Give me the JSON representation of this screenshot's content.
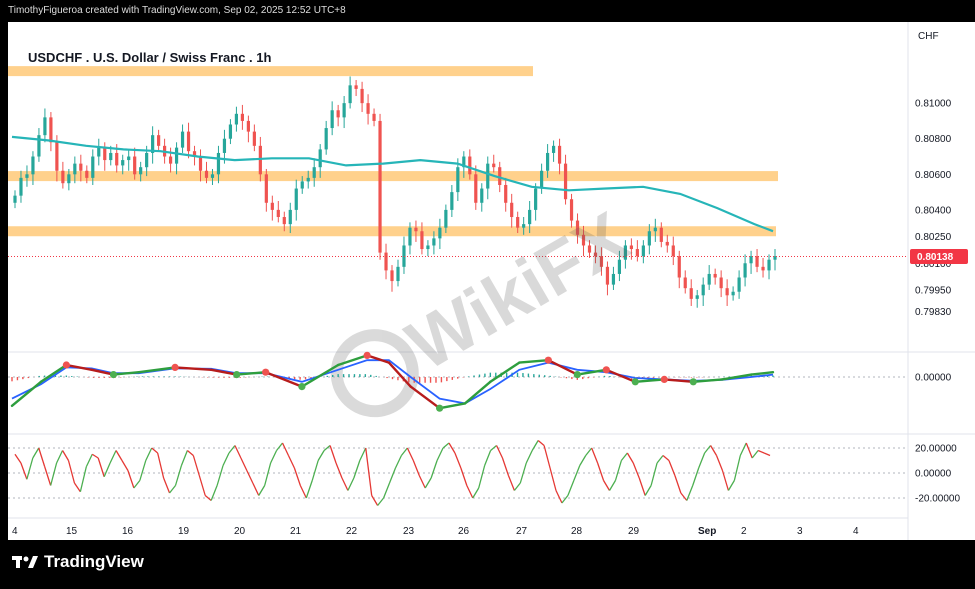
{
  "header": {
    "attribution": "TimothyFigueroa created with TradingView.com, Sep 02, 2025 12:52 UTC+8"
  },
  "symbol_title": "USDCHF . U.S. Dollar / Swiss Franc . 1h",
  "currency_label": "CHF",
  "brand": "TradingView",
  "watermark": "WikiFX",
  "colors": {
    "up": "#26a69a",
    "down": "#ef5350",
    "ma": "#26b5b8",
    "zone": "#ffcc80",
    "price_tag": "#f23645",
    "macd_fast": "#2e9e3e",
    "macd_slow": "#2962ff",
    "macd_down": "#b71c1c",
    "osc_up": "#4caf50",
    "osc_down": "#e53935"
  },
  "chart_data": {
    "type": "candlestick",
    "symbol": "USDCHF",
    "timeframe": "1h",
    "price_axis": {
      "ylim": [
        0.7968,
        0.8122
      ],
      "ticks": [
        "0.81000",
        "0.80800",
        "0.80600",
        "0.80400",
        "0.80250",
        "0.80100",
        "0.79950",
        "0.79830"
      ],
      "current_price": "0.80138"
    },
    "x_axis": {
      "ticks": [
        "4",
        "15",
        "16",
        "19",
        "20",
        "21",
        "22",
        "23",
        "26",
        "27",
        "28",
        "29",
        "Sep",
        "2",
        "3",
        "4"
      ]
    },
    "horizontal_zones": [
      {
        "level": 0.8118
      },
      {
        "level": 0.8059
      },
      {
        "level": 0.8028
      }
    ],
    "moving_average": [
      [
        0,
        0.8081
      ],
      [
        10,
        0.8079
      ],
      [
        20,
        0.8076
      ],
      [
        30,
        0.8074
      ],
      [
        40,
        0.8073
      ],
      [
        50,
        0.807
      ],
      [
        60,
        0.8068
      ],
      [
        70,
        0.8069
      ],
      [
        80,
        0.8069
      ],
      [
        90,
        0.8065
      ],
      [
        100,
        0.8066
      ],
      [
        110,
        0.8068
      ],
      [
        120,
        0.8066
      ],
      [
        130,
        0.8059
      ],
      [
        140,
        0.8053
      ],
      [
        150,
        0.8051
      ],
      [
        160,
        0.8052
      ],
      [
        170,
        0.8053
      ],
      [
        180,
        0.8049
      ],
      [
        190,
        0.8041
      ],
      [
        200,
        0.8032
      ],
      [
        205,
        0.8028
      ]
    ],
    "candles_close": [
      0.8048,
      0.8058,
      0.806,
      0.807,
      0.8082,
      0.8092,
      0.8078,
      0.8062,
      0.8055,
      0.806,
      0.8066,
      0.8062,
      0.8058,
      0.807,
      0.8075,
      0.8068,
      0.8072,
      0.8065,
      0.8068,
      0.807,
      0.806,
      0.8064,
      0.8072,
      0.8082,
      0.8076,
      0.807,
      0.8066,
      0.8075,
      0.8084,
      0.8073,
      0.807,
      0.8062,
      0.8058,
      0.806,
      0.8072,
      0.808,
      0.8088,
      0.8094,
      0.809,
      0.8084,
      0.8076,
      0.806,
      0.8044,
      0.804,
      0.8036,
      0.8032,
      0.804,
      0.8052,
      0.8056,
      0.8058,
      0.8064,
      0.8074,
      0.8086,
      0.8096,
      0.8092,
      0.81,
      0.811,
      0.8108,
      0.81,
      0.8094,
      0.809,
      0.8016,
      0.8006,
      0.8,
      0.8008,
      0.802,
      0.803,
      0.8028,
      0.8018,
      0.802,
      0.8024,
      0.803,
      0.804,
      0.805,
      0.8064,
      0.807,
      0.806,
      0.8044,
      0.8052,
      0.8066,
      0.8064,
      0.8054,
      0.8044,
      0.8036,
      0.803,
      0.8032,
      0.804,
      0.8052,
      0.8062,
      0.8072,
      0.8076,
      0.8066,
      0.8046,
      0.8034,
      0.8026,
      0.802,
      0.8016,
      0.8014,
      0.8008,
      0.7998,
      0.8004,
      0.8012,
      0.802,
      0.8018,
      0.8014,
      0.802,
      0.8028,
      0.803,
      0.8022,
      0.802,
      0.8014,
      0.8002,
      0.7996,
      0.799,
      0.7992,
      0.7998,
      0.8004,
      0.8002,
      0.7996,
      0.7992,
      0.7994,
      0.8002,
      0.801,
      0.8014,
      0.8008,
      0.8006,
      0.8012,
      0.8014
    ],
    "macd": {
      "zero": "0.00000",
      "fast_line": [
        [
          0,
          -0.6
        ],
        [
          8,
          -0.1
        ],
        [
          15,
          0.25
        ],
        [
          22,
          0.15
        ],
        [
          28,
          0.05
        ],
        [
          35,
          0.1
        ],
        [
          45,
          0.2
        ],
        [
          55,
          0.15
        ],
        [
          62,
          0.05
        ],
        [
          70,
          0.1
        ],
        [
          80,
          -0.2
        ],
        [
          90,
          0.25
        ],
        [
          98,
          0.45
        ],
        [
          104,
          0.3
        ],
        [
          110,
          -0.2
        ],
        [
          118,
          -0.65
        ],
        [
          125,
          -0.55
        ],
        [
          132,
          -0.1
        ],
        [
          140,
          0.3
        ],
        [
          148,
          0.35
        ],
        [
          156,
          0.05
        ],
        [
          164,
          0.15
        ],
        [
          172,
          -0.1
        ],
        [
          180,
          -0.05
        ],
        [
          188,
          -0.1
        ],
        [
          196,
          -0.05
        ],
        [
          204,
          0.05
        ],
        [
          210,
          0.1
        ]
      ],
      "slow_line": [
        [
          0,
          -0.45
        ],
        [
          8,
          -0.15
        ],
        [
          15,
          0.2
        ],
        [
          22,
          0.18
        ],
        [
          28,
          0.08
        ],
        [
          35,
          0.08
        ],
        [
          45,
          0.18
        ],
        [
          55,
          0.17
        ],
        [
          62,
          0.08
        ],
        [
          70,
          0.08
        ],
        [
          80,
          -0.1
        ],
        [
          90,
          0.15
        ],
        [
          98,
          0.35
        ],
        [
          104,
          0.35
        ],
        [
          110,
          0.0
        ],
        [
          118,
          -0.45
        ],
        [
          125,
          -0.55
        ],
        [
          132,
          -0.25
        ],
        [
          140,
          0.15
        ],
        [
          148,
          0.3
        ],
        [
          156,
          0.15
        ],
        [
          164,
          0.1
        ],
        [
          172,
          -0.02
        ],
        [
          180,
          -0.05
        ],
        [
          188,
          -0.08
        ],
        [
          196,
          -0.06
        ],
        [
          204,
          0.0
        ],
        [
          210,
          0.05
        ]
      ],
      "ticks": [
        "0.00000"
      ]
    },
    "oscillator": {
      "ticks": [
        "20.00000",
        "0.00000",
        "-20.00000"
      ],
      "values": [
        15,
        8,
        -5,
        12,
        20,
        5,
        -10,
        8,
        18,
        10,
        -8,
        -15,
        5,
        15,
        12,
        -3,
        8,
        18,
        10,
        2,
        -12,
        -6,
        10,
        20,
        16,
        -4,
        -16,
        -10,
        6,
        18,
        14,
        -2,
        -18,
        -22,
        -10,
        6,
        16,
        22,
        12,
        2,
        -8,
        -18,
        -10,
        8,
        18,
        24,
        14,
        4,
        -10,
        -20,
        -6,
        10,
        18,
        22,
        8,
        -4,
        -14,
        -4,
        10,
        20,
        -18,
        -26,
        -20,
        -8,
        4,
        14,
        20,
        10,
        -2,
        -12,
        -4,
        10,
        20,
        24,
        16,
        4,
        -10,
        -20,
        -12,
        6,
        18,
        22,
        12,
        -2,
        -14,
        -8,
        8,
        18,
        26,
        22,
        4,
        -14,
        -24,
        -18,
        -6,
        6,
        14,
        20,
        8,
        -6,
        -14,
        -6,
        10,
        16,
        8,
        -4,
        -18,
        -10,
        8,
        14,
        10,
        -2,
        -16,
        -22,
        -10,
        4,
        16,
        22,
        14,
        2,
        -14,
        -6,
        14,
        24,
        12,
        18,
        16,
        14
      ]
    }
  }
}
